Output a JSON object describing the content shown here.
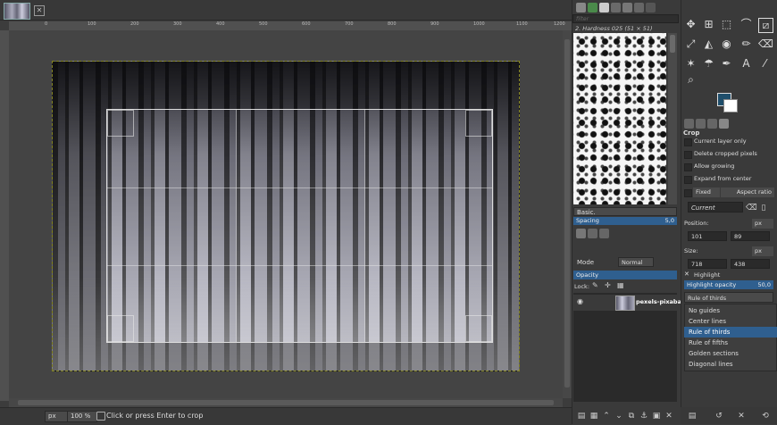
{
  "ruler": {
    "ticks": [
      "0",
      "100",
      "200",
      "300",
      "400",
      "500",
      "600",
      "700",
      "800",
      "900",
      "1000",
      "1100",
      "1200"
    ]
  },
  "statusbar": {
    "unit": "px",
    "zoom": "100 %",
    "message": "Click or press Enter to crop"
  },
  "brushes": {
    "filter_placeholder": "filter",
    "selected_brush": "2. Hardness 025 (51 × 51)",
    "preset": "Basic.",
    "spacing_label": "Spacing",
    "spacing_value": "5,0"
  },
  "layers": {
    "mode_label": "Mode",
    "mode_value": "Normal",
    "opacity_label": "Opacity",
    "lock_label": "Lock:",
    "layer_name": "pexels-pixabay-"
  },
  "tool_options": {
    "title": "Crop",
    "options": [
      "Current layer only",
      "Delete cropped pixels",
      "Allow growing",
      "Expand from center"
    ],
    "fixed_label": "Fixed",
    "aspect_label": "Aspect ratio",
    "current_label": "Current",
    "position_label": "Position:",
    "position_unit": "px",
    "position_x": "101",
    "position_y": "89",
    "size_label": "Size:",
    "size_unit": "px",
    "size_w": "718",
    "size_h": "438",
    "highlight_label": "Highlight",
    "highlight_opacity_label": "Highlight opacity",
    "highlight_opacity_value": "50,0",
    "guides_selected": "Rule of thirds",
    "guides_options": [
      "No guides",
      "Center lines",
      "Rule of thirds",
      "Rule of fifths",
      "Golden sections",
      "Diagonal lines"
    ]
  },
  "colors": {
    "foreground": "#1f4e6b",
    "background": "#ffffff",
    "accent": "#2f5f8f"
  }
}
